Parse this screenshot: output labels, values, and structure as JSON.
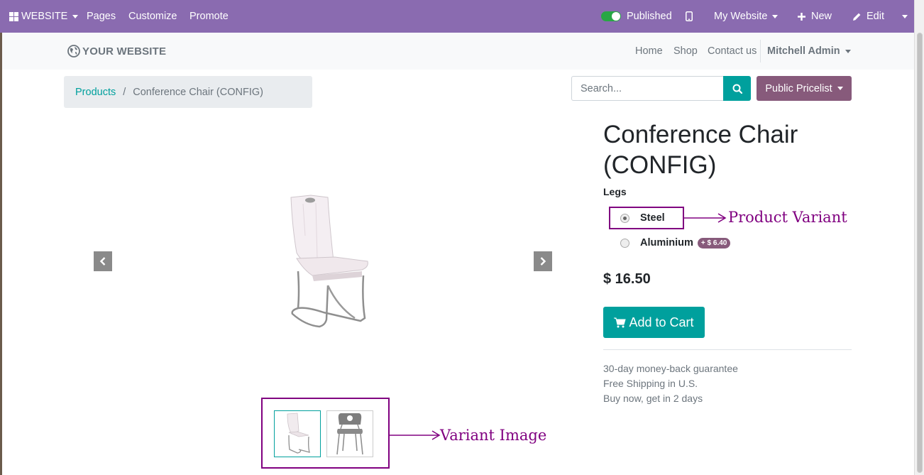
{
  "topbar": {
    "website_label": "WEBSITE",
    "pages": "Pages",
    "customize": "Customize",
    "promote": "Promote",
    "published": "Published",
    "my_website": "My Website",
    "new": "New",
    "edit": "Edit"
  },
  "header": {
    "logo": "YOUR WEBSITE",
    "nav": [
      "Home",
      "Shop",
      "Contact us"
    ],
    "user": "Mitchell Admin"
  },
  "breadcrumb": {
    "products": "Products",
    "separator": "/",
    "current": "Conference Chair (CONFIG)"
  },
  "search": {
    "placeholder": "Search..."
  },
  "pricelist": "Public Pricelist",
  "product": {
    "title_line1": "Conference Chair",
    "title_line2": "(CONFIG)",
    "attribute": "Legs",
    "options": [
      {
        "label": "Steel",
        "checked": true
      },
      {
        "label": "Aluminium",
        "badge": "+ $ 6.40"
      }
    ],
    "price": "$ 16.50",
    "add_to_cart": "Add to Cart",
    "info": [
      "30-day money-back guarantee",
      "Free Shipping in U.S.",
      "Buy now, get in 2 days"
    ]
  },
  "annotations": {
    "variant": "Product  Variant",
    "image": "Variant  Image"
  },
  "colors": {
    "admin_bar": "#8a6bb0",
    "accent": "#00a09d",
    "brand": "#875A7B",
    "annotation": "#800080"
  }
}
